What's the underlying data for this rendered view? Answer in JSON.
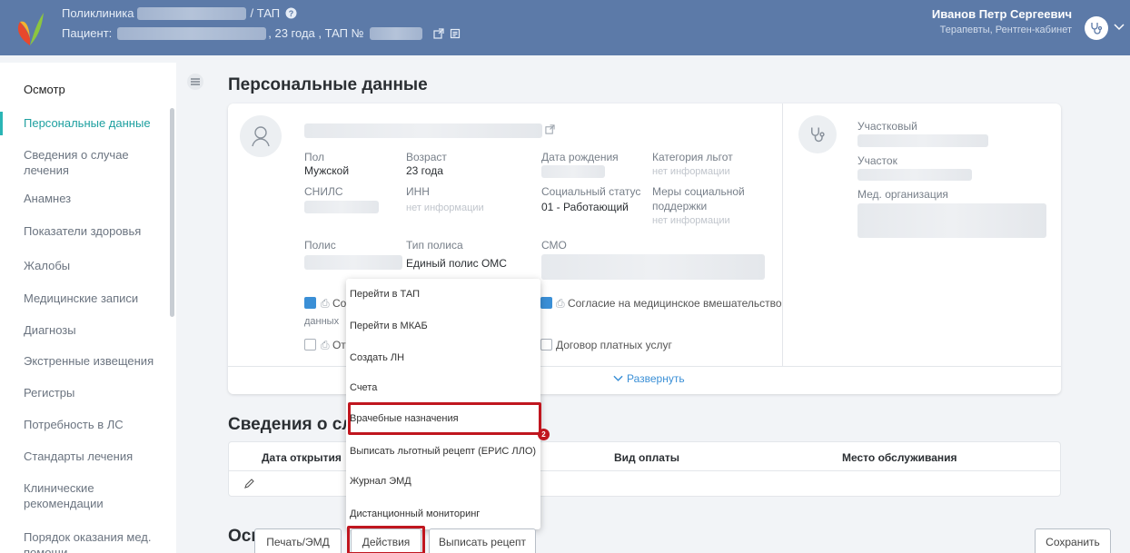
{
  "header": {
    "clinic_label": "Поликлиника",
    "tap_label": "/ ТАП",
    "patient_label": "Пациент:",
    "patient_age": ", 23 года , ТАП №",
    "user_name": "Иванов Петр Сергеевич",
    "user_role": "Терапевты, Рентген-кабинет"
  },
  "sidebar": {
    "title": "Осмотр",
    "items": [
      "Персональные данные",
      "Сведения о случае лечения",
      "Анамнез",
      "Показатели здоровья",
      "Жалобы",
      "Медицинские записи",
      "Диагнозы",
      "Экстренные извещения",
      "Регистры",
      "Потребность в ЛС",
      "Стандарты лечения",
      "Клинические рекомендации",
      "Порядок оказания мед. помощи"
    ]
  },
  "personal": {
    "title": "Персональные данные",
    "gender_label": "Пол",
    "gender_value": "Мужской",
    "age_label": "Возраст",
    "age_value": "23 года",
    "birth_label": "Дата рождения",
    "benefit_label": "Категория льгот",
    "benefit_value": "нет информации",
    "snils_label": "СНИЛС",
    "inn_label": "ИНН",
    "inn_value": "нет информации",
    "social_label": "Социальный статус",
    "social_value": "01 - Работающий",
    "support_label_1": "Меры социальной",
    "support_label_2": "поддержки",
    "support_value": "нет информации",
    "policy_label": "Полис",
    "policy_type_label": "Тип полиса",
    "policy_type_value": "Единый полис ОМС",
    "smo_label": "СМО",
    "consent_data_1": "Сог",
    "consent_data_2": "данных",
    "refusal": "От",
    "consent_med": "Согласие на медицинское вмешательство",
    "paid_contract": "Договор платных услуг",
    "expand": "Развернуть",
    "district_doctor_label": "Участковый",
    "district_label": "Участок",
    "org_label": "Мед. организация"
  },
  "case": {
    "title": "Сведения о сл",
    "columns": [
      "Дата открытия",
      "Вид оплаты",
      "Место обслуживания"
    ]
  },
  "exam": {
    "title": "Осмотр"
  },
  "dropdown": {
    "items": [
      "Перейти в ТАП",
      "Перейти в МКАБ",
      "Создать ЛН",
      "Счета",
      "Врачебные назначения",
      "Выписать льготный рецепт (ЕРИС ЛЛО)",
      "Журнал ЭМД",
      "Дистанционный мониторинг"
    ],
    "badge": "2"
  },
  "buttons": {
    "print": "Печать/ЭМД",
    "actions": "Действия",
    "prescription": "Выписать рецепт",
    "save": "Сохранить"
  },
  "colors": {
    "header_bg": "#5c7aa8",
    "accent_teal": "#2ab5b5",
    "link_blue": "#3a8fd6",
    "highlight_red": "#c0161f"
  }
}
